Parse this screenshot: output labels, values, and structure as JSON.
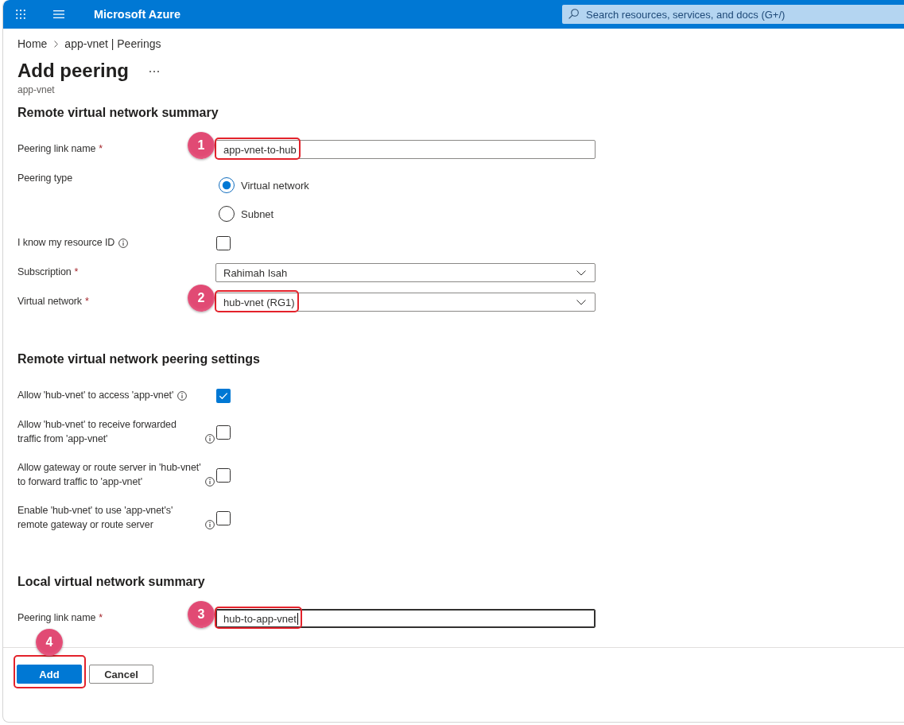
{
  "top_bar": {
    "title": "Microsoft Azure",
    "search": {
      "placeholder": "Search resources, services, and docs (G+/)"
    }
  },
  "breadcrumb": [
    {
      "label": "Home"
    },
    {
      "label": "app-vnet | Peerings"
    }
  ],
  "header": {
    "title": "Add peering",
    "subtitle": "app-vnet"
  },
  "sections": [
    {
      "heading": "Remote virtual network summary",
      "fields": [
        {
          "kind": "text",
          "label": "Peering link name",
          "required_mark": "*",
          "value": "app-vnet-to-hub",
          "focused": false,
          "callout": "1"
        },
        {
          "kind": "radio",
          "label": "Peering type",
          "options": [
            {
              "label": "Virtual network",
              "selected": true
            },
            {
              "label": "Subnet",
              "selected": false
            }
          ]
        },
        {
          "kind": "checkbox",
          "label": "I know my resource ID",
          "info": true,
          "checked": false
        },
        {
          "kind": "dropdown",
          "label": "Subscription",
          "required_mark": "*",
          "value": "Rahimah Isah"
        },
        {
          "kind": "dropdown",
          "label": "Virtual network",
          "required_mark": "*",
          "value": "hub-vnet (RG1)",
          "callout": "2"
        }
      ]
    },
    {
      "heading": "Remote virtual network peering settings",
      "fields": [
        {
          "kind": "checkbox",
          "label": "Allow 'hub-vnet' to access 'app-vnet'",
          "info": true,
          "checked": true
        },
        {
          "kind": "checkbox",
          "label": "Allow 'hub-vnet' to receive forwarded traffic from 'app-vnet'",
          "info": true,
          "checked": false
        },
        {
          "kind": "checkbox",
          "label": "Allow gateway or route server in 'hub-vnet' to forward traffic to 'app-vnet'",
          "info": true,
          "checked": false
        },
        {
          "kind": "checkbox",
          "label": "Enable 'hub-vnet' to use 'app-vnet's' remote gateway or route server",
          "info": true,
          "checked": false
        }
      ]
    },
    {
      "heading": "Local virtual network summary",
      "fields": [
        {
          "kind": "text",
          "label": "Peering link name",
          "required_mark": "*",
          "value": "hub-to-app-vnet",
          "focused": true,
          "callout": "3"
        }
      ]
    }
  ],
  "footer": {
    "buttons": [
      {
        "label": "Add",
        "kind": "primary",
        "callout": "4"
      },
      {
        "label": "Cancel",
        "kind": "secondary"
      }
    ]
  }
}
